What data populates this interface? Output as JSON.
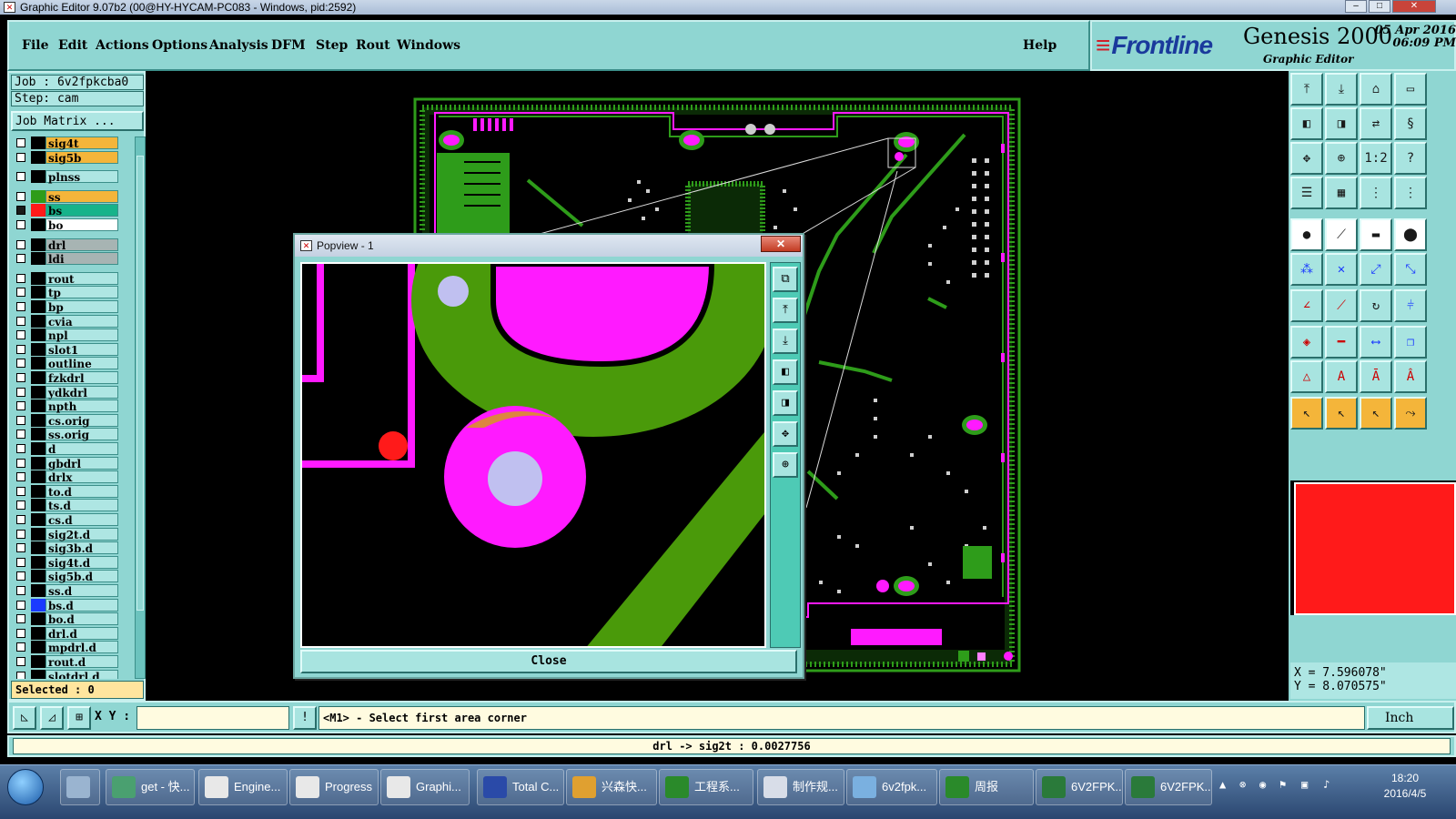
{
  "window": {
    "title": "Graphic Editor 9.07b2 (00@HY-HYCAM-PC083 - Windows, pid:2592)"
  },
  "menu": {
    "items": [
      "File",
      "Edit",
      "Actions",
      "Options",
      "Analysis",
      "DFM",
      "Step",
      "Rout",
      "Windows"
    ],
    "help": "Help"
  },
  "brand": {
    "logo": "Frontline",
    "product": "Genesis 2000",
    "subtitle": "Graphic Editor",
    "date": "05 Apr 2016",
    "time": "06:09 PM"
  },
  "job": {
    "job_label": "Job : 6v2fpkcba0",
    "step_label": "Step: cam",
    "matrix_button": "Job Matrix ..."
  },
  "layers": [
    {
      "name": "sig4t",
      "bg": "#f4b53a",
      "swatch": "#000000"
    },
    {
      "name": "sig5b",
      "bg": "#f4b53a",
      "swatch": "#000000"
    },
    {
      "name": "plnss",
      "bg": "#aee6e3",
      "swatch": "#000000"
    },
    {
      "name": "ss",
      "bg": "#f4b53a",
      "swatch": "#2e9c1a"
    },
    {
      "name": "bs",
      "bg": "#17b38a",
      "swatch": "#ff1a1a",
      "checked": true
    },
    {
      "name": "bo",
      "bg": "#ffffff",
      "swatch": "#000000"
    },
    {
      "name": "drl",
      "bg": "#a7b4b3",
      "swatch": "#000000"
    },
    {
      "name": "ldi",
      "bg": "#a7b4b3",
      "swatch": "#000000"
    },
    {
      "name": "rout",
      "bg": "#aee6e3",
      "swatch": "#000000"
    },
    {
      "name": "tp",
      "bg": "#aee6e3",
      "swatch": "#000000"
    },
    {
      "name": "bp",
      "bg": "#aee6e3",
      "swatch": "#000000"
    },
    {
      "name": "cvia",
      "bg": "#aee6e3",
      "swatch": "#000000"
    },
    {
      "name": "npl",
      "bg": "#aee6e3",
      "swatch": "#000000"
    },
    {
      "name": "slot1",
      "bg": "#aee6e3",
      "swatch": "#000000"
    },
    {
      "name": "outline",
      "bg": "#aee6e3",
      "swatch": "#000000"
    },
    {
      "name": "fzkdrl",
      "bg": "#aee6e3",
      "swatch": "#000000"
    },
    {
      "name": "ydkdrl",
      "bg": "#aee6e3",
      "swatch": "#000000"
    },
    {
      "name": "npth",
      "bg": "#aee6e3",
      "swatch": "#000000"
    },
    {
      "name": "cs.orig",
      "bg": "#aee6e3",
      "swatch": "#000000"
    },
    {
      "name": "ss.orig",
      "bg": "#aee6e3",
      "swatch": "#000000"
    },
    {
      "name": "d",
      "bg": "#aee6e3",
      "swatch": "#000000"
    },
    {
      "name": "gbdrl",
      "bg": "#aee6e3",
      "swatch": "#000000"
    },
    {
      "name": "drlx",
      "bg": "#aee6e3",
      "swatch": "#000000"
    },
    {
      "name": "to.d",
      "bg": "#aee6e3",
      "swatch": "#000000"
    },
    {
      "name": "ts.d",
      "bg": "#aee6e3",
      "swatch": "#000000"
    },
    {
      "name": "cs.d",
      "bg": "#aee6e3",
      "swatch": "#000000"
    },
    {
      "name": "sig2t.d",
      "bg": "#aee6e3",
      "swatch": "#000000"
    },
    {
      "name": "sig3b.d",
      "bg": "#aee6e3",
      "swatch": "#000000"
    },
    {
      "name": "sig4t.d",
      "bg": "#aee6e3",
      "swatch": "#000000"
    },
    {
      "name": "sig5b.d",
      "bg": "#aee6e3",
      "swatch": "#000000"
    },
    {
      "name": "ss.d",
      "bg": "#aee6e3",
      "swatch": "#000000"
    },
    {
      "name": "bs.d",
      "bg": "#aee6e3",
      "swatch": "#1a3aff"
    },
    {
      "name": "bo.d",
      "bg": "#aee6e3",
      "swatch": "#000000"
    },
    {
      "name": "drl.d",
      "bg": "#aee6e3",
      "swatch": "#000000"
    },
    {
      "name": "mpdrl.d",
      "bg": "#aee6e3",
      "swatch": "#000000"
    },
    {
      "name": "rout.d",
      "bg": "#aee6e3",
      "swatch": "#000000"
    },
    {
      "name": "slotdrl.d",
      "bg": "#aee6e3",
      "swatch": "#000000"
    }
  ],
  "selected": "Selected : 0",
  "popview": {
    "title": "Popview - 1",
    "close_button": "Close"
  },
  "coords": {
    "x": "X = 7.596078\"",
    "y": "Y = 8.070575\""
  },
  "cmd": {
    "xy_label": "X Y :",
    "message": "<M1> - Select first area corner",
    "unit": "Inch"
  },
  "status": "drl -> sig2t : 0.0027756",
  "taskbar": {
    "items": [
      {
        "label": "get - 快...",
        "icon": "eye-icon"
      },
      {
        "label": "Engine...",
        "icon": "genesis-icon"
      },
      {
        "label": "Progress",
        "icon": "genesis-icon"
      },
      {
        "label": "Graphi...",
        "icon": "genesis-icon"
      },
      {
        "label": "Total C...",
        "icon": "floppy-icon"
      },
      {
        "label": "兴森快...",
        "icon": "shell-icon"
      },
      {
        "label": "工程系...",
        "icon": "f-icon"
      },
      {
        "label": "制作规...",
        "icon": "doc-icon"
      },
      {
        "label": "6v2fpk...",
        "icon": "notepad-icon"
      },
      {
        "label": "周报",
        "icon": "f-icon"
      },
      {
        "label": "6V2FPK...",
        "icon": "excel-icon"
      },
      {
        "label": "6V2FPK...",
        "icon": "excel-icon"
      }
    ],
    "time": "18:20",
    "date": "2016/4/5"
  }
}
